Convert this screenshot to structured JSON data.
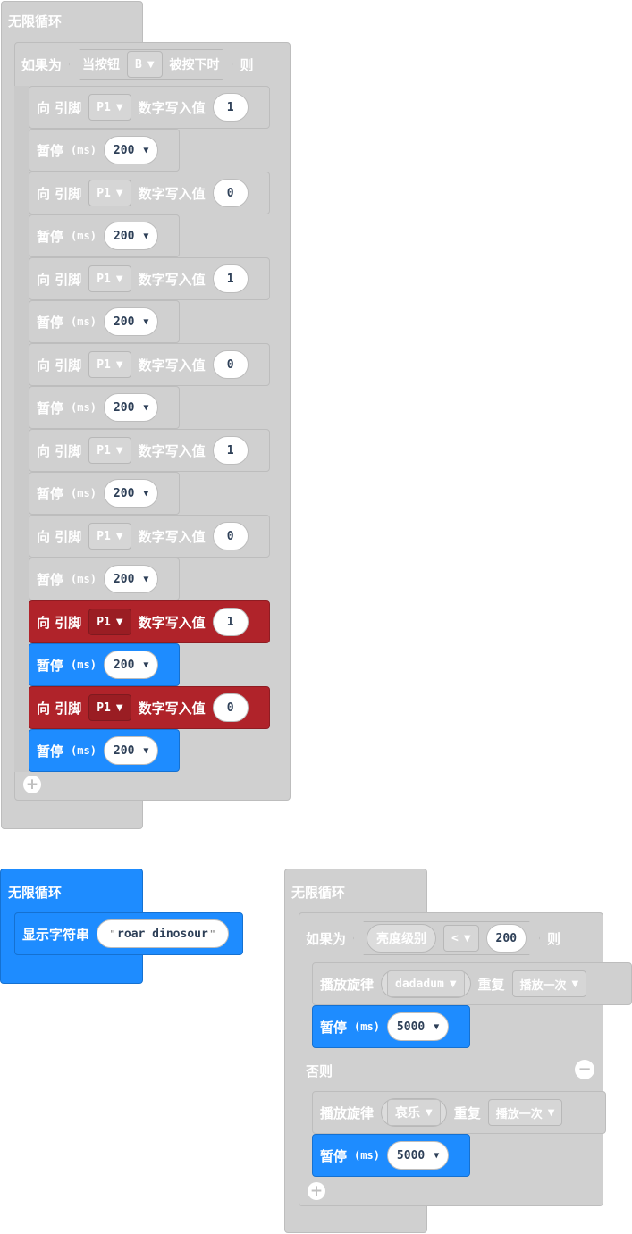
{
  "loop1": {
    "title": "无限循环",
    "if_label": "如果为",
    "then_label": "则",
    "condition": {
      "prefix": "当按钮",
      "button": "B",
      "suffix": "被按下时"
    },
    "blocks": [
      {
        "kind": "write",
        "style": "gray",
        "prefix": "向 引脚",
        "pin": "P1",
        "action": "数字写入值",
        "value": "1"
      },
      {
        "kind": "pause",
        "style": "gray",
        "label": "暂停",
        "unit": "(ms)",
        "value": "200"
      },
      {
        "kind": "write",
        "style": "gray",
        "prefix": "向 引脚",
        "pin": "P1",
        "action": "数字写入值",
        "value": "0"
      },
      {
        "kind": "pause",
        "style": "gray",
        "label": "暂停",
        "unit": "(ms)",
        "value": "200"
      },
      {
        "kind": "write",
        "style": "gray",
        "prefix": "向 引脚",
        "pin": "P1",
        "action": "数字写入值",
        "value": "1"
      },
      {
        "kind": "pause",
        "style": "gray",
        "label": "暂停",
        "unit": "(ms)",
        "value": "200"
      },
      {
        "kind": "write",
        "style": "gray",
        "prefix": "向 引脚",
        "pin": "P1",
        "action": "数字写入值",
        "value": "0"
      },
      {
        "kind": "pause",
        "style": "gray",
        "label": "暂停",
        "unit": "(ms)",
        "value": "200"
      },
      {
        "kind": "write",
        "style": "gray",
        "prefix": "向 引脚",
        "pin": "P1",
        "action": "数字写入值",
        "value": "1"
      },
      {
        "kind": "pause",
        "style": "gray",
        "label": "暂停",
        "unit": "(ms)",
        "value": "200"
      },
      {
        "kind": "write",
        "style": "gray",
        "prefix": "向 引脚",
        "pin": "P1",
        "action": "数字写入值",
        "value": "0"
      },
      {
        "kind": "pause",
        "style": "gray",
        "label": "暂停",
        "unit": "(ms)",
        "value": "200"
      },
      {
        "kind": "write",
        "style": "red",
        "prefix": "向 引脚",
        "pin": "P1",
        "action": "数字写入值",
        "value": "1"
      },
      {
        "kind": "pause",
        "style": "blue",
        "label": "暂停",
        "unit": "(ms)",
        "value": "200"
      },
      {
        "kind": "write",
        "style": "red",
        "prefix": "向 引脚",
        "pin": "P1",
        "action": "数字写入值",
        "value": "0"
      },
      {
        "kind": "pause",
        "style": "blue",
        "label": "暂停",
        "unit": "(ms)",
        "value": "200"
      }
    ]
  },
  "loop2": {
    "title": "无限循环",
    "show_label": "显示字符串",
    "text": "roar dinosour"
  },
  "loop3": {
    "title": "无限循环",
    "if_label": "如果为",
    "then_label": "则",
    "else_label": "否则",
    "condition": {
      "left": "亮度级别",
      "op": "<",
      "right": "200"
    },
    "if_branch": {
      "play_label": "播放旋律",
      "melody": "dadadum",
      "repeat_label": "重复",
      "repeat": "播放一次",
      "pause_label": "暂停",
      "pause_unit": "(ms)",
      "pause_value": "5000"
    },
    "else_branch": {
      "play_label": "播放旋律",
      "melody": "哀乐",
      "repeat_label": "重复",
      "repeat": "播放一次",
      "pause_label": "暂停",
      "pause_unit": "(ms)",
      "pause_value": "5000"
    }
  },
  "colors": {
    "gray": "#d0d0d0",
    "red": "#b0232a",
    "blue": "#1e8cff",
    "text": "#ffffff"
  },
  "icons": {
    "add": "plus-icon",
    "remove": "minus-icon",
    "dropdown": "triangle-down-icon"
  }
}
